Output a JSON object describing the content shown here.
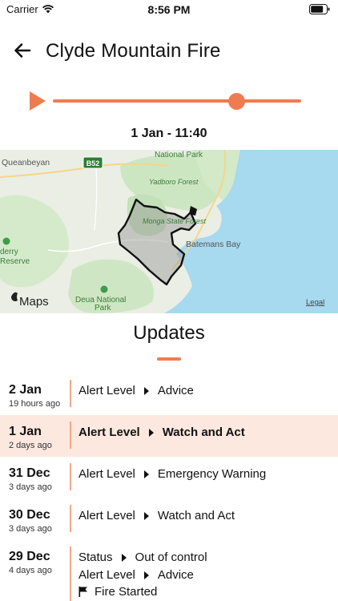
{
  "status_bar": {
    "carrier": "Carrier",
    "time": "8:56 PM"
  },
  "header": {
    "title": "Clyde Mountain Fire"
  },
  "playback": {
    "timestamp": "1 Jan - 11:40",
    "progress": 0.74,
    "accent": "#ee7c50"
  },
  "map": {
    "labels": {
      "queanbeyan": "Queanbeyan",
      "route": "B52",
      "national_park": "National Park",
      "yadboro": "Yadboro Forest",
      "state_forest": "Monga State Forest",
      "batemans_bay": "Batemans Bay",
      "deua": "Deua National",
      "park": "Park",
      "derry": "derry",
      "reserve": "Reserve",
      "maps_brand": "Maps",
      "legal": "Legal"
    }
  },
  "updates": {
    "heading": "Updates",
    "rows": [
      {
        "date": "2 Jan",
        "ago": "19 hours ago",
        "lines": [
          {
            "field": "Alert Level",
            "value": "Advice"
          }
        ]
      },
      {
        "date": "1 Jan",
        "ago": "2 days ago",
        "lines": [
          {
            "field": "Alert Level",
            "value": "Watch and Act"
          }
        ]
      },
      {
        "date": "31 Dec",
        "ago": "3 days ago",
        "lines": [
          {
            "field": "Alert Level",
            "value": "Emergency Warning"
          }
        ]
      },
      {
        "date": "30 Dec",
        "ago": "3 days ago",
        "lines": [
          {
            "field": "Alert Level",
            "value": "Watch and Act"
          }
        ]
      },
      {
        "date": "29 Dec",
        "ago": "4 days ago",
        "lines": [
          {
            "field": "Status",
            "value": "Out of control"
          },
          {
            "field": "Alert Level",
            "value": "Advice"
          }
        ],
        "event": "Fire Started"
      }
    ]
  }
}
